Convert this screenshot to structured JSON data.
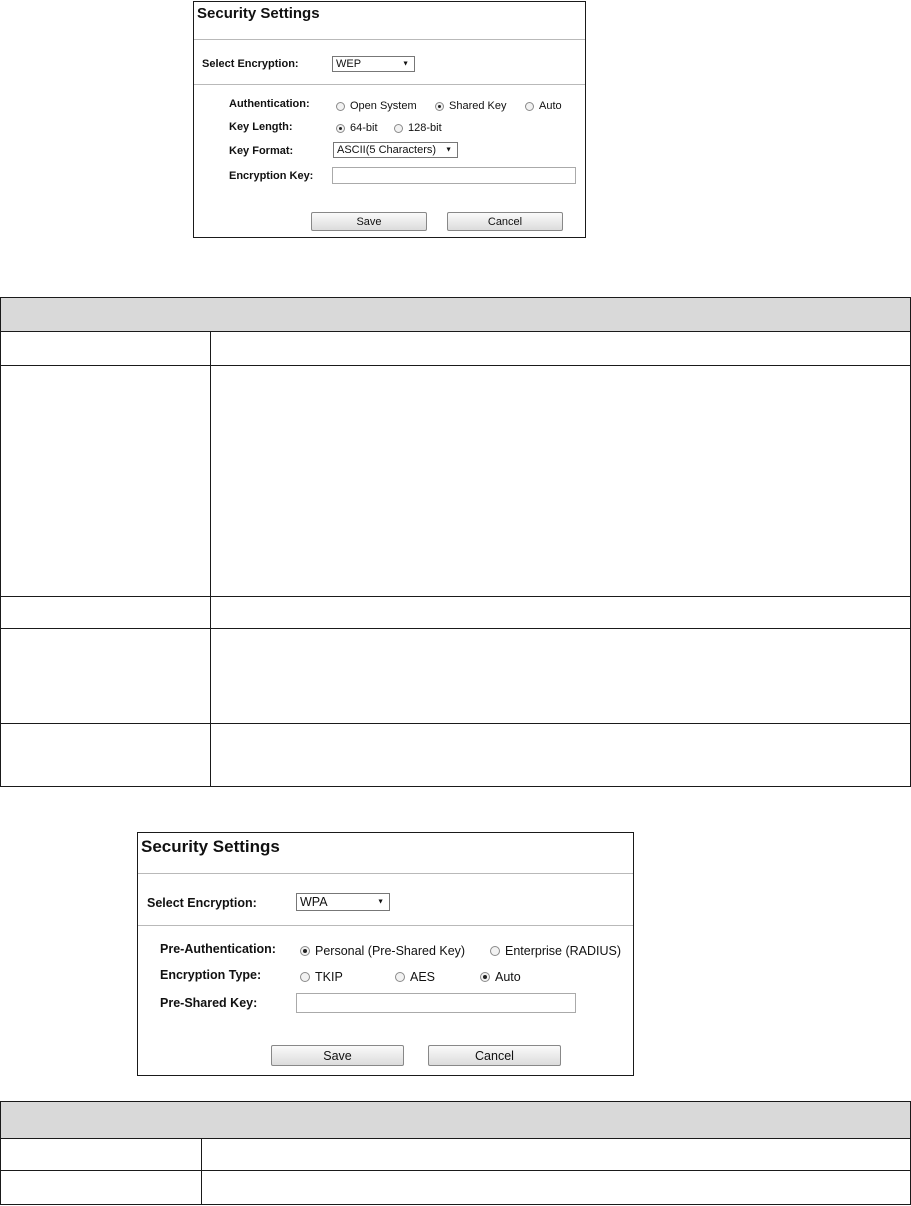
{
  "wep_panel": {
    "title": "Security Settings",
    "select_encryption_label": "Select Encryption:",
    "select_encryption_value": "WEP",
    "authentication_label": "Authentication:",
    "auth_options": [
      "Open System",
      "Shared Key",
      "Auto"
    ],
    "auth_selected": "Shared Key",
    "key_length_label": "Key Length:",
    "key_length_options": [
      "64-bit",
      "128-bit"
    ],
    "key_length_selected": "64-bit",
    "key_format_label": "Key Format:",
    "key_format_value": "ASCII(5 Characters)",
    "encryption_key_label": "Encryption Key:",
    "encryption_key_value": "",
    "save_label": "Save",
    "cancel_label": "Cancel"
  },
  "wpa_panel": {
    "title": "Security Settings",
    "select_encryption_label": "Select Encryption:",
    "select_encryption_value": "WPA",
    "pre_auth_label": "Pre-Authentication:",
    "pre_auth_options": [
      "Personal (Pre-Shared Key)",
      "Enterprise (RADIUS)"
    ],
    "pre_auth_selected": "Personal (Pre-Shared Key)",
    "encryption_type_label": "Encryption Type:",
    "encryption_type_options": [
      "TKIP",
      "AES",
      "Auto"
    ],
    "encryption_type_selected": "Auto",
    "psk_label": "Pre-Shared Key:",
    "psk_value": "",
    "save_label": "Save",
    "cancel_label": "Cancel"
  },
  "colors": {
    "table_header": "#d9d9d9",
    "border": "#1a1a1a"
  }
}
